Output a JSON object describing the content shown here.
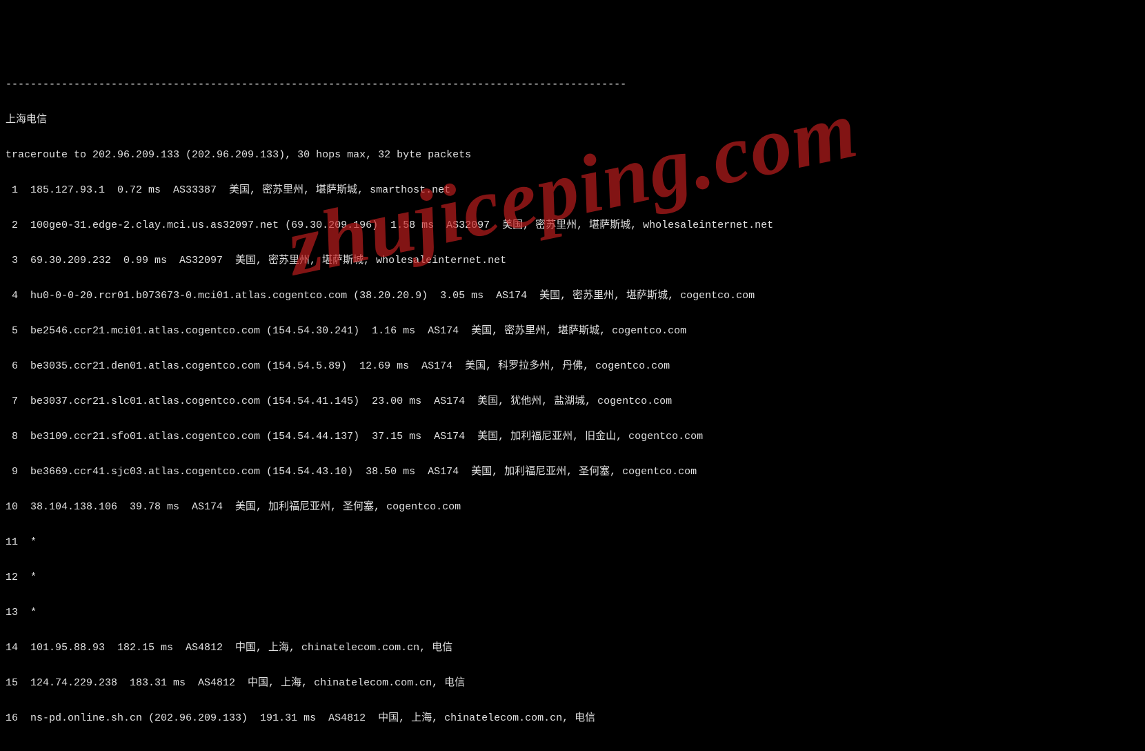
{
  "separator": "----------------------------------------------------------------------------------------------------",
  "title": "上海电信",
  "header": "traceroute to 202.96.209.133 (202.96.209.133), 30 hops max, 32 byte packets",
  "hops": [
    " 1  185.127.93.1  0.72 ms  AS33387  美国, 密苏里州, 堪萨斯城, smarthost.net",
    " 2  100ge0-31.edge-2.clay.mci.us.as32097.net (69.30.209.196)  1.58 ms  AS32097  美国, 密苏里州, 堪萨斯城, wholesaleinternet.net",
    " 3  69.30.209.232  0.99 ms  AS32097  美国, 密苏里州, 堪萨斯城, wholesaleinternet.net",
    " 4  hu0-0-0-20.rcr01.b073673-0.mci01.atlas.cogentco.com (38.20.20.9)  3.05 ms  AS174  美国, 密苏里州, 堪萨斯城, cogentco.com",
    " 5  be2546.ccr21.mci01.atlas.cogentco.com (154.54.30.241)  1.16 ms  AS174  美国, 密苏里州, 堪萨斯城, cogentco.com",
    " 6  be3035.ccr21.den01.atlas.cogentco.com (154.54.5.89)  12.69 ms  AS174  美国, 科罗拉多州, 丹佛, cogentco.com",
    " 7  be3037.ccr21.slc01.atlas.cogentco.com (154.54.41.145)  23.00 ms  AS174  美国, 犹他州, 盐湖城, cogentco.com",
    " 8  be3109.ccr21.sfo01.atlas.cogentco.com (154.54.44.137)  37.15 ms  AS174  美国, 加利福尼亚州, 旧金山, cogentco.com",
    " 9  be3669.ccr41.sjc03.atlas.cogentco.com (154.54.43.10)  38.50 ms  AS174  美国, 加利福尼亚州, 圣何塞, cogentco.com",
    "10  38.104.138.106  39.78 ms  AS174  美国, 加利福尼亚州, 圣何塞, cogentco.com",
    "11  *",
    "12  *",
    "13  *",
    "14  101.95.88.93  182.15 ms  AS4812  中国, 上海, chinatelecom.com.cn, 电信",
    "15  124.74.229.238  183.31 ms  AS4812  中国, 上海, chinatelecom.com.cn, 电信",
    "16  ns-pd.online.sh.cn (202.96.209.133)  191.31 ms  AS4812  中国, 上海, chinatelecom.com.cn, 电信"
  ],
  "watermark": "zhujiceping.com"
}
